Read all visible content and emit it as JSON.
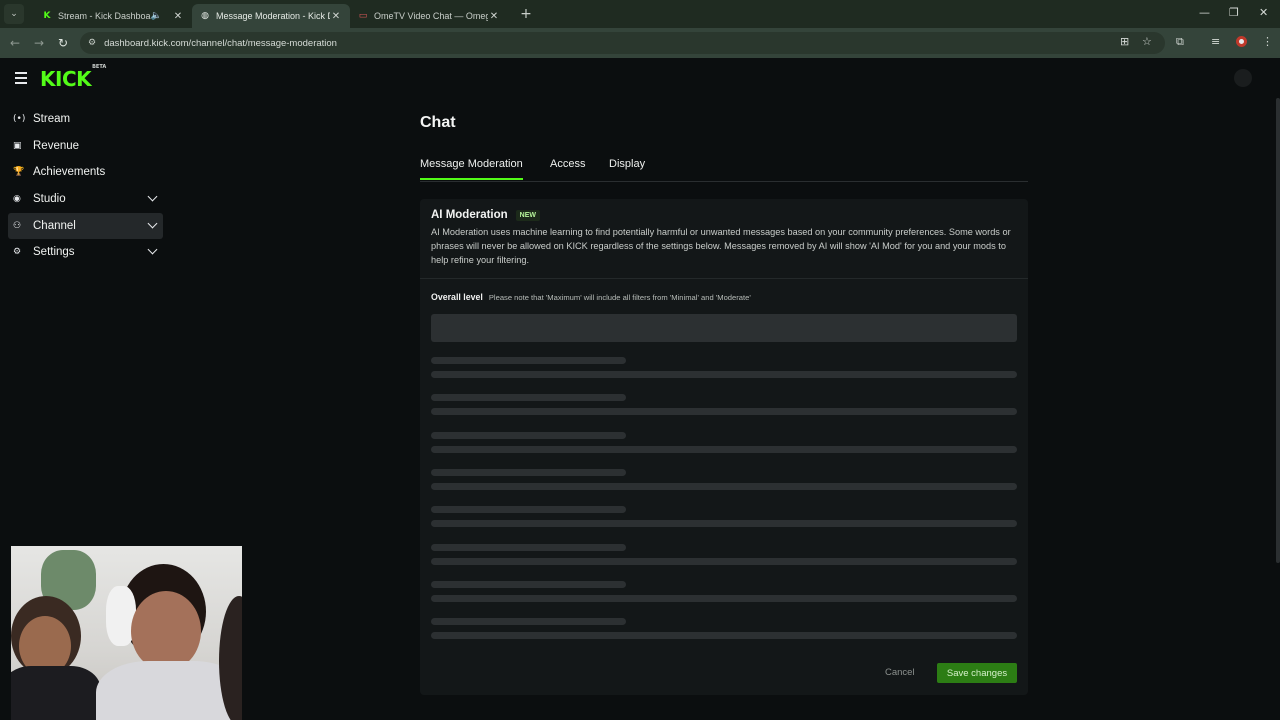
{
  "browser": {
    "tabs": [
      {
        "title": "Stream - Kick Dashboard",
        "favicon": "K",
        "favicon_color": "#53fc18",
        "audio": true,
        "active": false
      },
      {
        "title": "Message Moderation - Kick Das",
        "favicon": "◍",
        "favicon_color": "#c9cfca",
        "audio": false,
        "active": true
      },
      {
        "title": "OmeTV Video Chat — Omegle",
        "favicon": "▭",
        "favicon_color": "#e05a5a",
        "audio": false,
        "active": false
      }
    ],
    "tab_close": "✕",
    "new_tab": "+",
    "tab_search_icon": "⌄",
    "window_controls": {
      "minimize": "—",
      "restore": "❐",
      "close": "✕"
    },
    "nav": {
      "back": "←",
      "forward": "→",
      "reload": "↻"
    },
    "url": "dashboard.kick.com/channel/chat/message-moderation",
    "site_info_icon": "⚙",
    "toolbar_icons": {
      "translate": "⊞",
      "bookmark": "☆",
      "extensions": "⧉",
      "media": "≡",
      "menu": "⋮"
    }
  },
  "app": {
    "logo": "KICK",
    "logo_sup": "BETA"
  },
  "sidebar": {
    "items": [
      {
        "label": "Stream",
        "icon": "(•)",
        "has_chevron": false,
        "active": false
      },
      {
        "label": "Revenue",
        "icon": "▣",
        "has_chevron": false,
        "active": false
      },
      {
        "label": "Achievements",
        "icon": "🏆",
        "has_chevron": false,
        "active": false
      },
      {
        "label": "Studio",
        "icon": "◉",
        "has_chevron": true,
        "active": false
      },
      {
        "label": "Channel",
        "icon": "⚇",
        "has_chevron": true,
        "active": true
      },
      {
        "label": "Settings",
        "icon": "⚙",
        "has_chevron": true,
        "active": false
      }
    ]
  },
  "main": {
    "title": "Chat",
    "tabs": [
      {
        "label": "Message Moderation",
        "active": true
      },
      {
        "label": "Access",
        "active": false
      },
      {
        "label": "Display",
        "active": false
      }
    ],
    "card": {
      "title": "AI Moderation",
      "badge": "NEW",
      "description": "AI Moderation uses machine learning to find potentially harmful or unwanted messages based on your community preferences. Some words or phrases will never be allowed on KICK regardless of the settings below. Messages removed by AI will show 'AI Mod' for you and your mods to help refine your filtering.",
      "overall_label": "Overall level",
      "overall_note": "Please note that 'Maximum' will include all filters from 'Minimal' and 'Moderate'",
      "cancel_label": "Cancel",
      "save_label": "Save changes"
    }
  },
  "colors": {
    "accent": "#53fc18",
    "save_button": "#2c7d14",
    "background": "#0b0e0f",
    "card": "#131718",
    "skeleton": "#2c3032"
  }
}
